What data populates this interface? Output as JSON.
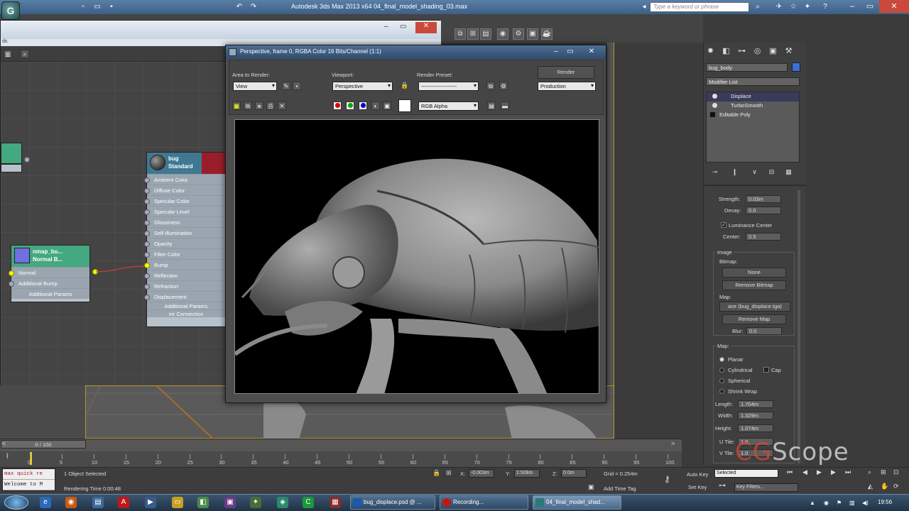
{
  "app": {
    "title": "Autodesk 3ds Max  2013 x64      04_final_model_shading_03.max",
    "search_placeholder": "Type a keyword or phrase",
    "logo_glyph": "G"
  },
  "slate": {
    "menu_strip": "ds",
    "nodes": {
      "normal_map": {
        "title_line1": "nmap_bu...",
        "title_line2": "Normal B...",
        "slots": [
          "Normal",
          "Additional Bump",
          "Additional Params"
        ]
      },
      "bug_material": {
        "title_line1": "bug",
        "title_line2": "Standard",
        "slots": [
          "Ambient Color",
          "Diffuse Color",
          "Specular Color",
          "Specular Level",
          "Glossiness",
          "Self-Illumination",
          "Opacity",
          "Filter Color",
          "Bump",
          "Reflection",
          "Refraction",
          "Displacement",
          "Additional Params",
          "mr Connection"
        ]
      }
    }
  },
  "render_frame": {
    "title": "Perspective, frame 0, RGBA Color 16 Bits/Channel (1:1)",
    "area_label": "Area to Render:",
    "area_value": "View",
    "viewport_label": "Viewport:",
    "viewport_value": "Perspective",
    "preset_label": "Render Preset:",
    "preset_value": "--------------------",
    "render_button": "Render",
    "mode_value": "Production",
    "channel_value": "RGB Alpha"
  },
  "command_panel": {
    "object_name": "bug_body",
    "modifier_list_label": "Modifier List",
    "modifier_stack": [
      "Displace",
      "TurboSmooth",
      "Editable Poly"
    ],
    "strength_label": "Strength:",
    "strength_value": "0.03m",
    "decay_label": "Decay:",
    "decay_value": "0.0",
    "luminance_center_label": "Luminance Center",
    "center_label": "Center:",
    "center_value": "0.5",
    "image_group": "Image",
    "bitmap_label": "Bitmap:",
    "bitmap_button": "None",
    "remove_bitmap_button": "Remove Bitmap",
    "map_label": "Map:",
    "map_button": "ace (bug_displace.tga)",
    "remove_map_button": "Remove Map",
    "blur_label": "Blur:",
    "blur_value": "0.0",
    "map_group": "Map:",
    "mapping_options": [
      "Planar",
      "Cylindrical",
      "Spherical",
      "Shrink Wrap"
    ],
    "cap_label": "Cap",
    "length_label": "Length:",
    "length_value": "1.704m",
    "width_label": "Width:",
    "width_value": "1.329m",
    "height_label": "Height:",
    "height_value": "1.074m",
    "utile_label": "U Tile:",
    "utile_value": "1.0",
    "vtile_label": "V Tile:",
    "vtile_value": "1.0"
  },
  "timeline": {
    "slider_label": "0 / 100",
    "ticks": [
      "0",
      "5",
      "10",
      "15",
      "20",
      "25",
      "30",
      "35",
      "40",
      "45",
      "50",
      "55",
      "60",
      "65",
      "70",
      "75",
      "80",
      "85",
      "90",
      "95",
      "100"
    ]
  },
  "status": {
    "maxscript_lines": [
      "max quick re",
      "Welcome to M"
    ],
    "selection": "1 Object Selected",
    "render_time": "Rendering Time  0:00:48",
    "x_label": "X:",
    "x_value": "-0.003m",
    "y_label": "Y:",
    "y_value": "2.508m",
    "z_label": "Z:",
    "z_value": "0.0m",
    "grid": "Grid = 0.254m",
    "add_time_tag": "Add Time Tag",
    "auto_key": "Auto Key",
    "auto_key_value": "Selected",
    "set_key": "Set Key",
    "key_filters": "Key Filters..."
  },
  "watermark": {
    "cg": "CG",
    "scope": "Scope"
  },
  "taskbar": {
    "tasks": [
      "bug_displace.psd @ ...",
      "Recording...",
      "04_final_model_shad..."
    ],
    "clock": "19:56"
  },
  "colors": {
    "accent_title": "#3b5f86",
    "node_header_green": "#44a880",
    "node_header_blue": "#3f7890",
    "wire": "#d63a3a",
    "selection_blue": "#3a6fd6"
  }
}
